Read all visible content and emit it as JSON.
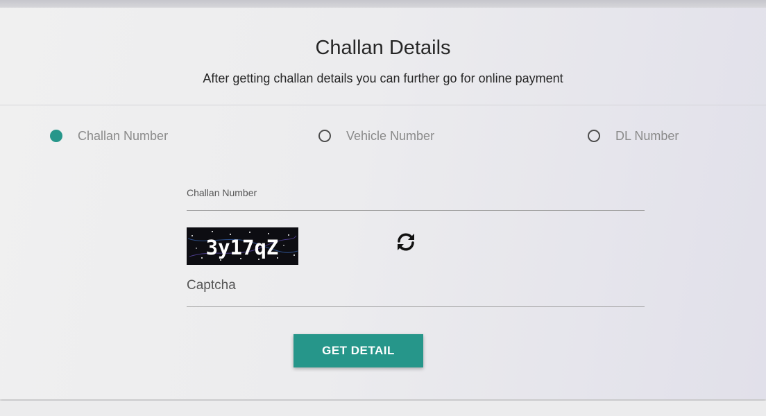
{
  "header": {
    "title": "Challan Details",
    "subtitle": "After getting challan details you can further go for online payment"
  },
  "search_type": {
    "options": [
      {
        "label": "Challan Number",
        "checked": true
      },
      {
        "label": "Vehicle Number",
        "checked": false
      },
      {
        "label": "DL Number",
        "checked": false
      }
    ]
  },
  "form": {
    "challan_label": "Challan Number",
    "challan_value": "",
    "captcha_text": "3y17qZ",
    "captcha_placeholder": "Captcha",
    "captcha_value": "",
    "submit_label": "GET DETAIL"
  },
  "icons": {
    "refresh": "refresh-icon"
  },
  "colors": {
    "accent": "#26968a",
    "text": "#262626",
    "muted": "#8a8a8a"
  }
}
